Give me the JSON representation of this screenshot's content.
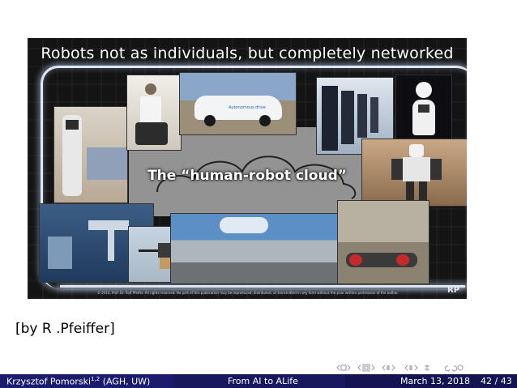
{
  "slide": {
    "image_title": "Robots not as individuals, but completely networked",
    "cloud_label": "The “human-robot cloud”",
    "copyright_text": "© 2014, Prof. Dr. Rolf Pfeifer. All rights reserved. No part of this publication may be reproduced, distributed, or transmitted in any form without the prior written permission of the author.",
    "logo_text": "RP",
    "car_text": "Autonomous drive",
    "credit": "[by R .Pfeiffer]"
  },
  "footer": {
    "author": "Krzysztof Pomorski",
    "author_sup": "1,2",
    "affiliation": "(AGH, UW)",
    "title": "From AI to ALife",
    "date": "March 13, 2018",
    "page": "42 / 43"
  },
  "colors": {
    "footer_bg": "#1a1a66",
    "frame_glow": "#dfe8f0"
  }
}
